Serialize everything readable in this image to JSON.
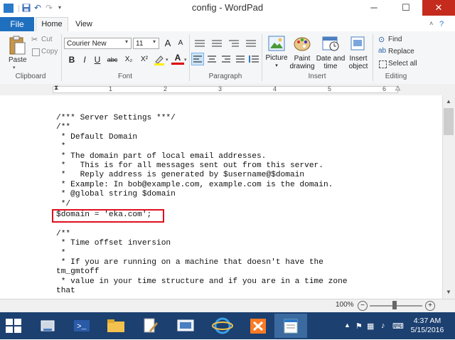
{
  "window": {
    "title": "config - WordPad",
    "minimize": "─",
    "maximize": "☐",
    "close": "✕"
  },
  "quick_access": {
    "save_icon": "save-icon",
    "undo_icon": "undo-icon",
    "redo_icon": "redo-icon",
    "customize_icon": "chevron-down-icon"
  },
  "tabs": {
    "file": "File",
    "home": "Home",
    "view": "View"
  },
  "ribbon": {
    "clipboard": {
      "label": "Clipboard",
      "paste": "Paste",
      "cut": "Cut",
      "copy": "Copy"
    },
    "font": {
      "label": "Font",
      "family": "Courier New",
      "size": "11",
      "grow": "A",
      "shrink": "A",
      "bold": "B",
      "italic": "I",
      "underline": "U",
      "strike": "abc",
      "subscript": "X₂",
      "superscript": "X²",
      "color": "A"
    },
    "paragraph": {
      "label": "Paragraph"
    },
    "insert": {
      "label": "Insert",
      "picture": "Picture",
      "paint1": "Paint",
      "paint2": "drawing",
      "date1": "Date and",
      "date2": "time",
      "object1": "Insert",
      "object2": "object"
    },
    "editing": {
      "label": "Editing",
      "find": "Find",
      "replace": "Replace",
      "select_all": "Select all"
    }
  },
  "ruler": {
    "marks": [
      "1",
      "2",
      "3",
      "4",
      "5",
      "6"
    ]
  },
  "document": {
    "lines": [
      "/*** Server Settings ***/",
      "/**",
      " * Default Domain",
      " *",
      " * The domain part of local email addresses.",
      " *   This is for all messages sent out from this server.",
      " *   Reply address is generated by $username@$domain",
      " * Example: In bob@example.com, example.com is the domain.",
      " * @global string $domain",
      " */",
      "$domain = 'eka.com';",
      "",
      "/**",
      " * Time offset inversion",
      " *",
      " * If you are running on a machine that doesn't have the",
      "tm_gmtoff",
      " * value in your time structure and if you are in a time zone",
      "that"
    ]
  },
  "statusbar": {
    "zoom": "100%",
    "zoom_out": "−",
    "zoom_in": "+"
  },
  "taskbar": {
    "time": "4:37 AM",
    "date": "5/15/2016"
  }
}
